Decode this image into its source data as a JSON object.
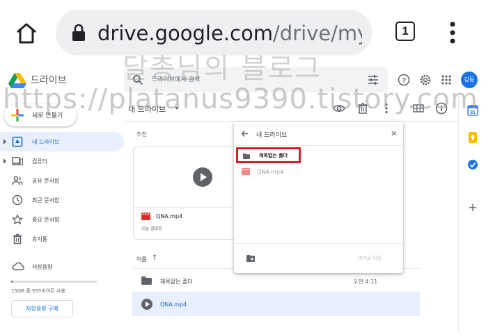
{
  "browser": {
    "url_domain": "drive.google.com",
    "url_path": "/drive/my",
    "tab_count": "1",
    "icons": [
      "home-icon",
      "lock-icon",
      "more-vert-icon"
    ]
  },
  "header": {
    "app_name": "드라이브",
    "search_placeholder": "드라이브에서 검색",
    "avatar_initials": "강동",
    "icons": [
      "drive-logo",
      "search-icon",
      "tune-icon",
      "help-icon",
      "settings-icon",
      "apps-icon"
    ]
  },
  "watermark": {
    "line1": "달총님의 블로그",
    "line2": "https://platanus9390.tistory.com"
  },
  "sidebar": {
    "new_label": "새로 만들기",
    "items": [
      {
        "label": "내 드라이브",
        "icon": "my-drive-icon",
        "active": true,
        "expandable": true
      },
      {
        "label": "컴퓨터",
        "icon": "computer-icon",
        "active": false,
        "expandable": true
      },
      {
        "label": "공유 문서함",
        "icon": "people-icon",
        "active": false,
        "expandable": false
      },
      {
        "label": "최근 문서함",
        "icon": "clock-icon",
        "active": false,
        "expandable": false
      },
      {
        "label": "중요 문서함",
        "icon": "star-icon",
        "active": false,
        "expandable": false
      },
      {
        "label": "휴지통",
        "icon": "trash-icon",
        "active": false,
        "expandable": false
      }
    ],
    "storage_label": "저장용량",
    "storage_usage_text": "15GB 중 555바이트 사용",
    "storage_used_fraction": 0.02,
    "buy_storage_label": "저장용량 구매"
  },
  "toolbar": {
    "title": "내 드라이브",
    "icons": [
      "eye-icon",
      "trash-icon",
      "more-vert-icon",
      "grid-view-icon",
      "info-icon"
    ]
  },
  "main": {
    "suggested_label": "추천",
    "suggested_card": {
      "name": "QNA.mp4",
      "subtitle": "오늘 열었음"
    },
    "column_header": "이름",
    "files": [
      {
        "name": "제목없는 폴더",
        "type": "folder",
        "modified": "오전 4:11",
        "selected": false
      },
      {
        "name": "QNA.mp4",
        "type": "video",
        "modified": "",
        "selected": true
      }
    ]
  },
  "move_dialog": {
    "title": "내 드라이브",
    "folder_name": "제목없는 폴더",
    "file_name": "QNA.mp4",
    "move_button": "여기로 이동",
    "highlight_color": "#d2232a"
  },
  "right_rail": {
    "icons": [
      "calendar-icon",
      "keep-icon",
      "tasks-icon",
      "add-icon"
    ]
  }
}
